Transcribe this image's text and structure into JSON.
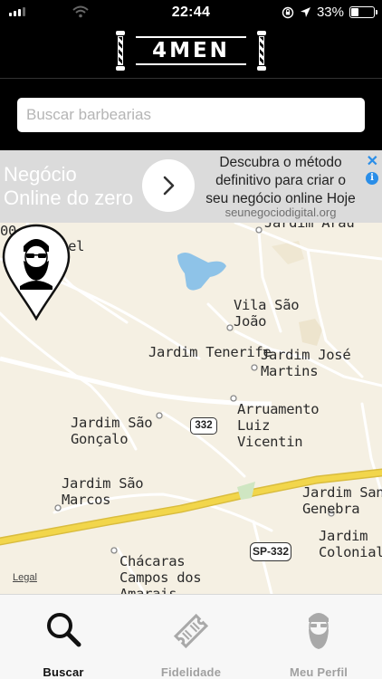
{
  "status": {
    "time": "22:44",
    "battery": "33%",
    "battery_level": 0.33
  },
  "header": {
    "logo_text": "4MEN"
  },
  "search": {
    "placeholder": "Buscar barbearias",
    "value": ""
  },
  "ad": {
    "headline_line1": "Negócio",
    "headline_line2": "Online do zero",
    "body_line1": "Descubra o método",
    "body_line2": "definitivo para criar o",
    "body_line3": "seu negócio online Hoje",
    "url": "seunegociodigital.org",
    "close_symbol": "✕",
    "info_symbol": "i",
    "accent_color": "#2a8ee8"
  },
  "map": {
    "labels": {
      "betel": "Betel",
      "corner_number": "00",
      "jardim_arau": "Jardim Arau",
      "vila_sao_joao": "Vila São\nJoão",
      "jardim_tenerife": "Jardim Tenerife",
      "jardim_jose_martins": "Jardim José\nMartins",
      "arruamento": "Arruamento\nLuiz\nVicentin",
      "jardim_sao_goncalo": "Jardim São\nGonçalo",
      "jardim_sao_marcos": "Jardim São\nMarcos",
      "jardim_san_genebra": "Jardim San\nGenebra",
      "jardim_colonial": "Jardim\nColonial",
      "chacaras": "Chácaras\nCampos dos\nAmarais",
      "road_332": "332",
      "road_sp332": "SP-332"
    },
    "legal": "Legal",
    "highway_color": "#f2d64b"
  },
  "tabs": [
    {
      "label": "Buscar",
      "icon": "search-icon",
      "active": true
    },
    {
      "label": "Fidelidade",
      "icon": "ticket-icon",
      "active": false
    },
    {
      "label": "Meu Perfil",
      "icon": "bearded-man-icon",
      "active": false
    }
  ]
}
